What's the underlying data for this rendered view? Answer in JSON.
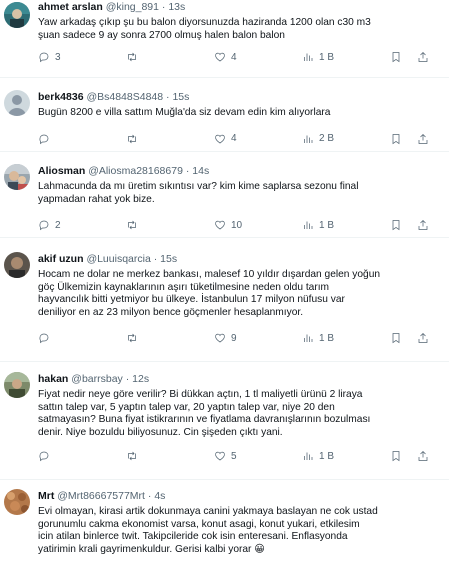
{
  "tweets": [
    {
      "name": "ahmet arslan",
      "handle": "@king_891",
      "dot": "·",
      "time": "13s",
      "text": "Yaw arkadaş çıkıp şu bu balon diyorsunuzda haziranda 1200 olan c30 m3\nşuan sadece 9 ay sonra 2700 olmuş halen balon balon",
      "replies": "3",
      "retweets": "",
      "likes": "4",
      "views": "1 B",
      "avatar_color": "#2a6b72"
    },
    {
      "name": "berk4836",
      "handle": "@Bs4848S4848",
      "dot": "·",
      "time": "15s",
      "text": "Bugün 8200 e villa sattım Muğla'da siz devam edin kim alıyorlara",
      "replies": "",
      "retweets": "",
      "likes": "4",
      "views": "2 B",
      "avatar_color": "#c9d3dc"
    },
    {
      "name": "Aliosman",
      "handle": "@Aliosma28168679",
      "dot": "·",
      "time": "14s",
      "text": "Lahmacunda da mı üretim sıkıntısı var? kim kime saplarsa sezonu final\nyapmadan rahat yok bize.",
      "replies": "2",
      "retweets": "",
      "likes": "10",
      "views": "1 B",
      "avatar_color": "#8e9aa5"
    },
    {
      "name": "akif uzun",
      "handle": "@Luuisqarcia",
      "dot": "·",
      "time": "15s",
      "text": "Hocam ne dolar ne merkez bankası, malesef 10 yıldır dışardan gelen yoğun\ngöç Ülkemizin kaynaklarının aşırı tüketilmesine neden oldu tarım\nhayvancılık bitti yetmiyor bu ülkeye. İstanbulun 17 milyon nüfusu var\ndeniliyor en az 23 milyon bence göçmenler hesaplanmıyor.",
      "replies": "",
      "retweets": "",
      "likes": "9",
      "views": "1 B",
      "avatar_color": "#4a4540"
    },
    {
      "name": "hakan",
      "handle": "@barrsbay",
      "dot": "·",
      "time": "12s",
      "text": "Fiyat nedir neye göre verilir? Bi dükkan açtın, 1 tl maliyetli ürünü 2 liraya\nsattın talep var, 5 yaptın talep var, 20 yaptın talep var, niye 20 den\nsatmayasın? Buna fiyat istikrarının ve fiyatlama davranışlarının bozulması\ndenir. Niye bozuldu biliyosunuz. Cin şişeden çıktı yani.",
      "replies": "",
      "retweets": "",
      "likes": "5",
      "views": "1 B",
      "avatar_color": "#6b7c5a"
    },
    {
      "name": "Mrt",
      "handle": "@Mrt86667577Mrt",
      "dot": "·",
      "time": "4s",
      "text": "Evi olmayan, kirasi artik dokunmaya canini yakmaya baslayan ne cok ustad\ngorunumlu cakma ekonomist varsa, konut asagi, konut yukari, etkilesim\nicin atilan binlerce twit. Takipcileride cok isin enteresani. Enflasyonda\nyatirimin krali gayrimenkuldur. Gerisi kalbi yorar 😀",
      "replies": "",
      "retweets": "",
      "likes": "",
      "views": "",
      "avatar_color": "#b07a4e"
    }
  ]
}
